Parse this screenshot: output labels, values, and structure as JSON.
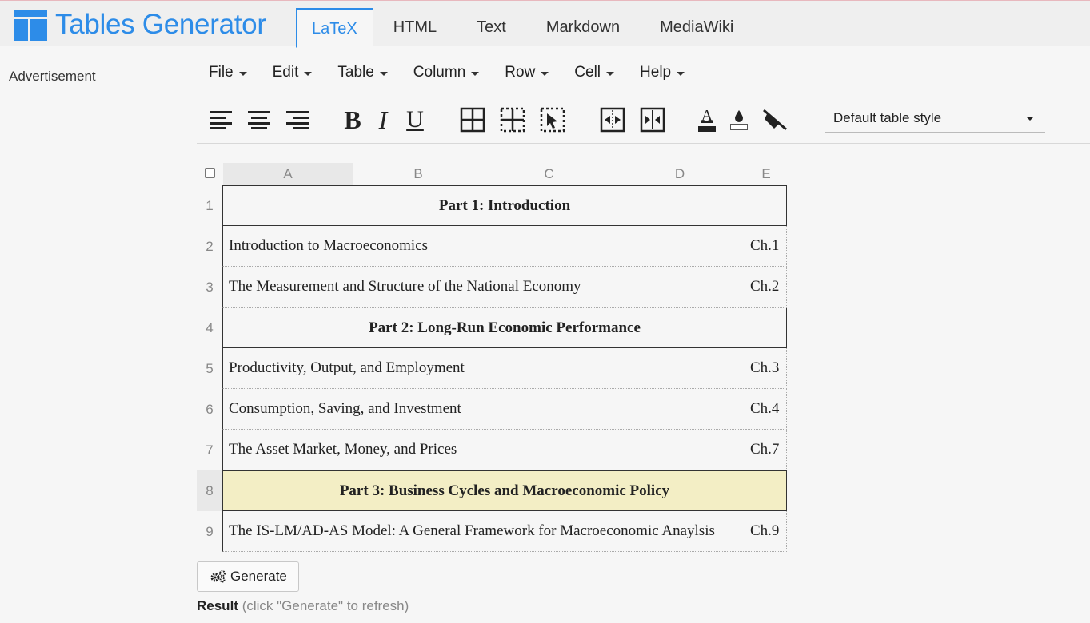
{
  "app": {
    "logo_text": "Tables Generator",
    "brand_color": "#2d8ce8"
  },
  "tabs": [
    {
      "label": "LaTeX",
      "active": true
    },
    {
      "label": "HTML",
      "active": false
    },
    {
      "label": "Text",
      "active": false
    },
    {
      "label": "Markdown",
      "active": false
    },
    {
      "label": "MediaWiki",
      "active": false
    }
  ],
  "sidebar": {
    "advertisement": "Advertisement"
  },
  "menus": [
    "File",
    "Edit",
    "Table",
    "Column",
    "Row",
    "Cell",
    "Help"
  ],
  "toolbar": {
    "icons": [
      "align-left-icon",
      "align-center-icon",
      "align-right-icon",
      "bold-icon",
      "italic-icon",
      "underline-icon",
      "all-borders-icon",
      "inner-borders-icon",
      "select-borders-icon",
      "merge-cells-icon",
      "split-cells-icon",
      "text-color-icon",
      "background-color-icon",
      "clear-format-icon"
    ],
    "bold_glyph": "B",
    "italic_glyph": "I",
    "underline_glyph": "U",
    "text_color_glyph": "A",
    "style_select": "Default table style"
  },
  "grid": {
    "columns": [
      "A",
      "B",
      "C",
      "D",
      "E"
    ],
    "selected_column": "A",
    "selected_row": "8",
    "rows": [
      {
        "num": "1",
        "merged": true,
        "text": "Part 1: Introduction"
      },
      {
        "num": "2",
        "text": "Introduction to Macroeconomics",
        "ch": "Ch.1"
      },
      {
        "num": "3",
        "text": "The Measurement and Structure of the National Economy",
        "ch": "Ch.2"
      },
      {
        "num": "4",
        "merged": true,
        "text": "Part 2: Long-Run Economic Performance"
      },
      {
        "num": "5",
        "text": "Productivity, Output, and Employment",
        "ch": "Ch.3"
      },
      {
        "num": "6",
        "text": "Consumption, Saving, and Investment",
        "ch": "Ch.4"
      },
      {
        "num": "7",
        "text": "The Asset Market, Money, and Prices",
        "ch": "Ch.7"
      },
      {
        "num": "8",
        "merged": true,
        "highlight": true,
        "text": "Part 3: Business Cycles and Macroeconomic Policy"
      },
      {
        "num": "9",
        "text": "The IS-LM/AD-AS Model: A General Framework for Macroeconomic Anaylsis",
        "ch": "Ch.9"
      }
    ]
  },
  "actions": {
    "generate_label": "Generate",
    "result_label": "Result",
    "result_hint": "(click \"Generate\" to refresh)"
  }
}
